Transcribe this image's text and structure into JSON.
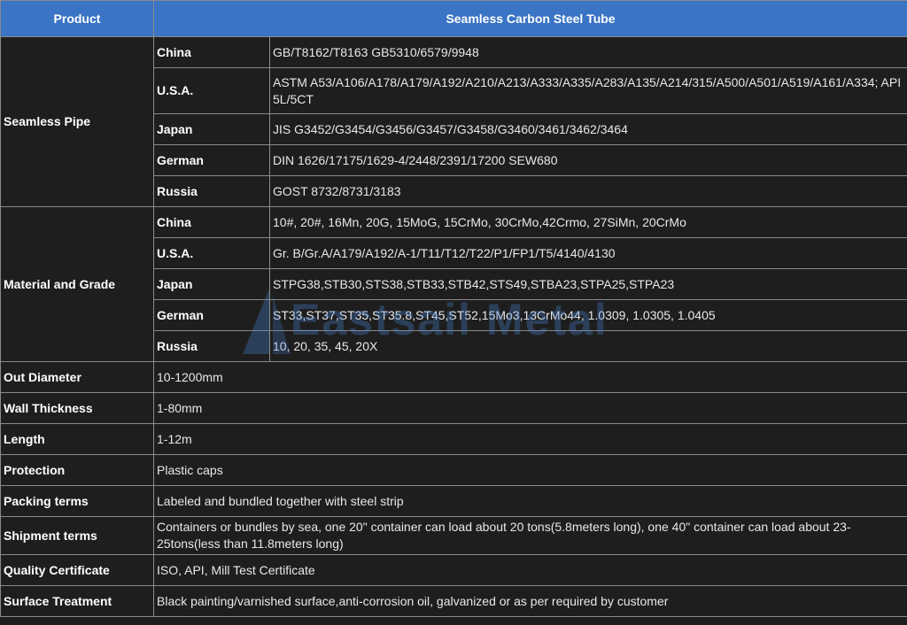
{
  "header": {
    "col1": "Product",
    "col2": "Seamless Carbon Steel Tube"
  },
  "seamless_pipe": {
    "label": "Seamless Pipe",
    "rows": [
      {
        "country": "China",
        "value": "GB/T8162/T8163 GB5310/6579/9948"
      },
      {
        "country": "U.S.A.",
        "value": "ASTM A53/A106/A178/A179/A192/A210/A213/A333/A335/A283/A135/A214/315/A500/A501/A519/A161/A334; API 5L/5CT"
      },
      {
        "country": "Japan",
        "value": "JIS G3452/G3454/G3456/G3457/G3458/G3460/3461/3462/3464"
      },
      {
        "country": "German",
        "value": "DIN 1626/17175/1629-4/2448/2391/17200 SEW680"
      },
      {
        "country": "Russia",
        "value": "GOST 8732/8731/3183"
      }
    ]
  },
  "material_grade": {
    "label": "Material and Grade",
    "rows": [
      {
        "country": "China",
        "value": "10#, 20#, 16Mn, 20G, 15MoG, 15CrMo, 30CrMo,42Crmo, 27SiMn, 20CrMo"
      },
      {
        "country": "U.S.A.",
        "value": "Gr. B/Gr.A/A179/A192/A-1/T11/T12/T22/P1/FP1/T5/4140/4130"
      },
      {
        "country": "Japan",
        "value": "STPG38,STB30,STS38,STB33,STB42,STS49,STBA23,STPA25,STPA23"
      },
      {
        "country": "German",
        "value": "ST33,ST37,ST35,ST35.8,ST45,ST52,15Mo3,13CrMo44, 1.0309, 1.0305, 1.0405"
      },
      {
        "country": "Russia",
        "value": "10, 20, 35, 45, 20X"
      }
    ]
  },
  "specs": [
    {
      "label": "Out Diameter",
      "value": "10-1200mm"
    },
    {
      "label": "Wall Thickness",
      "value": "1-80mm"
    },
    {
      "label": "Length",
      "value": "1-12m"
    },
    {
      "label": "Protection",
      "value": "Plastic caps"
    },
    {
      "label": "Packing terms",
      "value": "Labeled and bundled together with steel strip"
    },
    {
      "label": "Shipment terms",
      "value": "Containers or bundles by sea, one 20\" container can load about 20 tons(5.8meters long), one 40\" container can load about 23-25tons(less than 11.8meters long)"
    },
    {
      "label": "Quality Certificate",
      "value": "ISO, API, Mill Test Certificate"
    },
    {
      "label": "Surface Treatment",
      "value": "Black painting/varnished surface,anti-corrosion oil, galvanized or as per required by customer"
    }
  ],
  "watermark": {
    "text": "Eastsail Metal",
    "color": "#4a86d4"
  },
  "colors": {
    "header_bg": "#3a74c4",
    "body_bg": "#1e1e1e",
    "grid": "#8a8a8a"
  }
}
